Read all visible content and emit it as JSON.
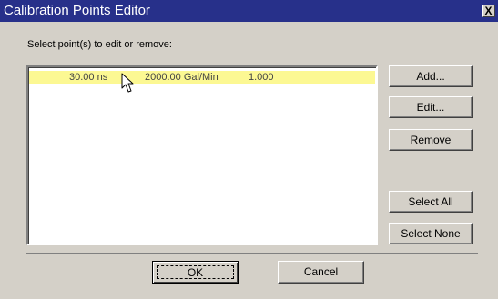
{
  "window": {
    "title": "Calibration Points Editor",
    "close_glyph": "X"
  },
  "instruction": "Select point(s) to edit or remove:",
  "points": [
    {
      "time": "30.00 ns",
      "flow": "2000.00 Gal/Min",
      "factor": "1.000",
      "selected": true
    }
  ],
  "buttons": {
    "add": "Add...",
    "edit": "Edit...",
    "remove": "Remove",
    "select_all": "Select All",
    "select_none": "Select None",
    "ok": "OK",
    "cancel": "Cancel"
  },
  "colors": {
    "title_bar": "#27308a",
    "selection": "#fcf893",
    "dialog_face": "#d4d0c8"
  },
  "icons": {
    "cursor": "mouse-pointer-icon",
    "close": "close-icon"
  }
}
